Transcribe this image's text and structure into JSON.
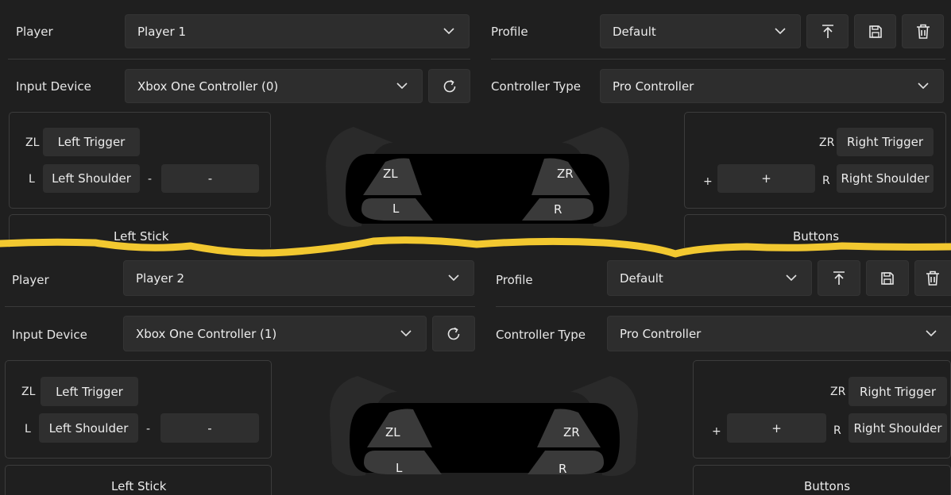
{
  "panels": [
    {
      "player_label": "Player",
      "player_value": "Player 1",
      "profile_label": "Profile",
      "profile_value": "Default",
      "input_device_label": "Input Device",
      "input_device_value": "Xbox One Controller (0)",
      "controller_type_label": "Controller Type",
      "controller_type_value": "Pro Controller",
      "left": {
        "zl_label": "ZL",
        "zl_button": "Left Trigger",
        "l_label": "L",
        "l_button": "Left Shoulder",
        "minus_label": "-",
        "minus_button": "-",
        "stick_title": "Left Stick"
      },
      "right": {
        "zr_label": "ZR",
        "zr_button": "Right Trigger",
        "plus_label": "+",
        "plus_button": "+",
        "r_label": "R",
        "r_button": "Right Shoulder",
        "buttons_title": "Buttons"
      },
      "diagram": {
        "zl": "ZL",
        "zr": "ZR",
        "l": "L",
        "r": "R"
      }
    },
    {
      "player_label": "Player",
      "player_value": "Player 2",
      "profile_label": "Profile",
      "profile_value": "Default",
      "input_device_label": "Input Device",
      "input_device_value": "Xbox One Controller (1)",
      "controller_type_label": "Controller Type",
      "controller_type_value": "Pro Controller",
      "left": {
        "zl_label": "ZL",
        "zl_button": "Left Trigger",
        "l_label": "L",
        "l_button": "Left Shoulder",
        "minus_label": "-",
        "minus_button": "-",
        "stick_title": "Left Stick"
      },
      "right": {
        "zr_label": "ZR",
        "zr_button": "Right Trigger",
        "plus_label": "+",
        "plus_button": "+",
        "r_label": "R",
        "r_button": "Right Shoulder",
        "buttons_title": "Buttons"
      },
      "diagram": {
        "zl": "ZL",
        "zr": "ZR",
        "l": "L",
        "r": "R"
      }
    }
  ],
  "icons": {
    "dropdown": "chevron-down-icon",
    "upload": "upload-icon",
    "save": "save-icon",
    "delete": "trash-icon",
    "refresh": "refresh-icon"
  },
  "colors": {
    "background": "#1f1f1f",
    "control": "#2d2d2d",
    "divider_highlight": "#f2c830"
  }
}
